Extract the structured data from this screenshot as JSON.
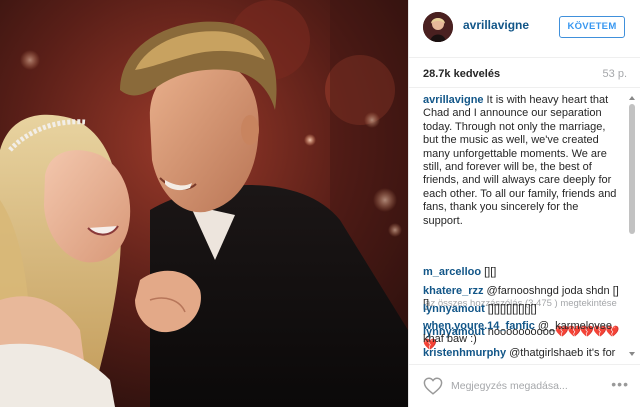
{
  "post": {
    "username": "avrillavigne",
    "follow_label": "KÖVETEM",
    "likes": "28.7k kedvelés",
    "time": "53 p.",
    "caption": {
      "username": "avrillavigne",
      "text": "It is with heavy heart that Chad and I announce our separation today. Through not only the marriage, but the music as well, we've created many unforgettable moments. We are still, and forever will be, the best of friends, and will always care deeply for each other. To all our family, friends and fans, thank you sincerely for the support."
    },
    "view_all": "az összes hozzászólás (3,475 ) megtekintése",
    "comments": [
      {
        "username": "lynnyamout",
        "text": "noooooooooo",
        "emoji": "💔💔💔💔💔💔"
      },
      {
        "username": "m_arcelloo",
        "text": "[][]"
      },
      {
        "username": "khatere_rzz",
        "text": "@farnooshngd joda shdn [][]"
      },
      {
        "username": "lynnyamout",
        "text": "[][][][][][][][]"
      },
      {
        "username": "when.youre.14_fanfic",
        "text": "@_karmelovee khaf baw :)"
      },
      {
        "username": "kristenhmurphy",
        "text": "@thatgirlshaeb it's for"
      }
    ],
    "comment_placeholder": "Megjegyzés megadása...",
    "more_label": "•••"
  },
  "icons": {
    "like": "heart-icon",
    "options": "more-options-icon"
  },
  "colors": {
    "username": "#125688",
    "follow_border": "#4090db",
    "muted": "#a5a7aa"
  }
}
